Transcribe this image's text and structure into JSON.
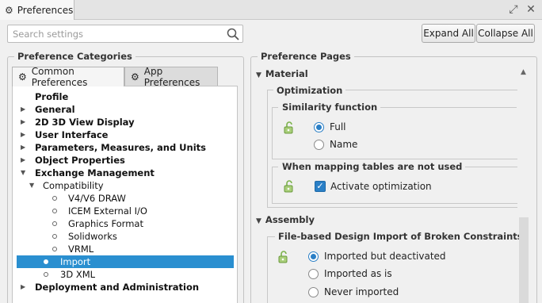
{
  "window": {
    "title": "Preferences",
    "icons": [
      "expand-icon",
      "close-icon"
    ]
  },
  "search": {
    "placeholder": "Search settings",
    "value": ""
  },
  "toolbar": {
    "expand_all": "Expand All",
    "collapse_all": "Collapse All"
  },
  "categories": {
    "group_title": "Preference Categories",
    "tabs": [
      {
        "label": "Common Preferences",
        "active": true
      },
      {
        "label": "App Preferences",
        "active": false
      }
    ],
    "tree": [
      {
        "label": "Profile",
        "bold": true,
        "arrow": "",
        "level": 0
      },
      {
        "label": "General",
        "bold": true,
        "arrow": "right",
        "level": 0
      },
      {
        "label": "2D 3D View Display",
        "bold": true,
        "arrow": "right",
        "level": 0
      },
      {
        "label": "User Interface",
        "bold": true,
        "arrow": "right",
        "level": 0
      },
      {
        "label": "Parameters, Measures, and Units",
        "bold": true,
        "arrow": "right",
        "level": 0
      },
      {
        "label": "Object Properties",
        "bold": true,
        "arrow": "right",
        "level": 0
      },
      {
        "label": "Exchange Management",
        "bold": true,
        "arrow": "down",
        "level": 0
      },
      {
        "label": "Compatibility",
        "bold": false,
        "arrow": "down",
        "level": 1
      },
      {
        "label": "V4/V6 DRAW",
        "bold": false,
        "arrow": "",
        "level": 2,
        "dot": true
      },
      {
        "label": "ICEM External I/O",
        "bold": false,
        "arrow": "",
        "level": 2,
        "dot": true
      },
      {
        "label": "Graphics Format",
        "bold": false,
        "arrow": "",
        "level": 2,
        "dot": true
      },
      {
        "label": "Solidworks",
        "bold": false,
        "arrow": "",
        "level": 2,
        "dot": true
      },
      {
        "label": "VRML",
        "bold": false,
        "arrow": "",
        "level": 2,
        "dot": true
      },
      {
        "label": "Import",
        "bold": false,
        "arrow": "",
        "level": 1,
        "dot": true,
        "selected": true
      },
      {
        "label": "3D XML",
        "bold": false,
        "arrow": "",
        "level": 1,
        "dot": true
      },
      {
        "label": "Deployment and Administration",
        "bold": true,
        "arrow": "right",
        "level": 0
      }
    ]
  },
  "pages": {
    "group_title": "Preference Pages",
    "material": {
      "title": "Material",
      "optimization_title": "Optimization",
      "similarity": {
        "title": "Similarity function",
        "options": [
          {
            "label": "Full",
            "selected": true
          },
          {
            "label": "Name",
            "selected": false
          }
        ]
      },
      "mapping": {
        "title": "When mapping tables are not used",
        "checkbox_label": "Activate optimization",
        "checked": true
      }
    },
    "assembly": {
      "title": "Assembly",
      "broken": {
        "title": "File-based Design Import of Broken Constraints",
        "options": [
          {
            "label": "Imported but deactivated",
            "selected": true
          },
          {
            "label": "Imported as is",
            "selected": false
          },
          {
            "label": "Never imported",
            "selected": false
          }
        ]
      }
    }
  },
  "colors": {
    "accent": "#2a7fc6",
    "selection": "#2a8fd0",
    "lock": "#7bb24a"
  }
}
